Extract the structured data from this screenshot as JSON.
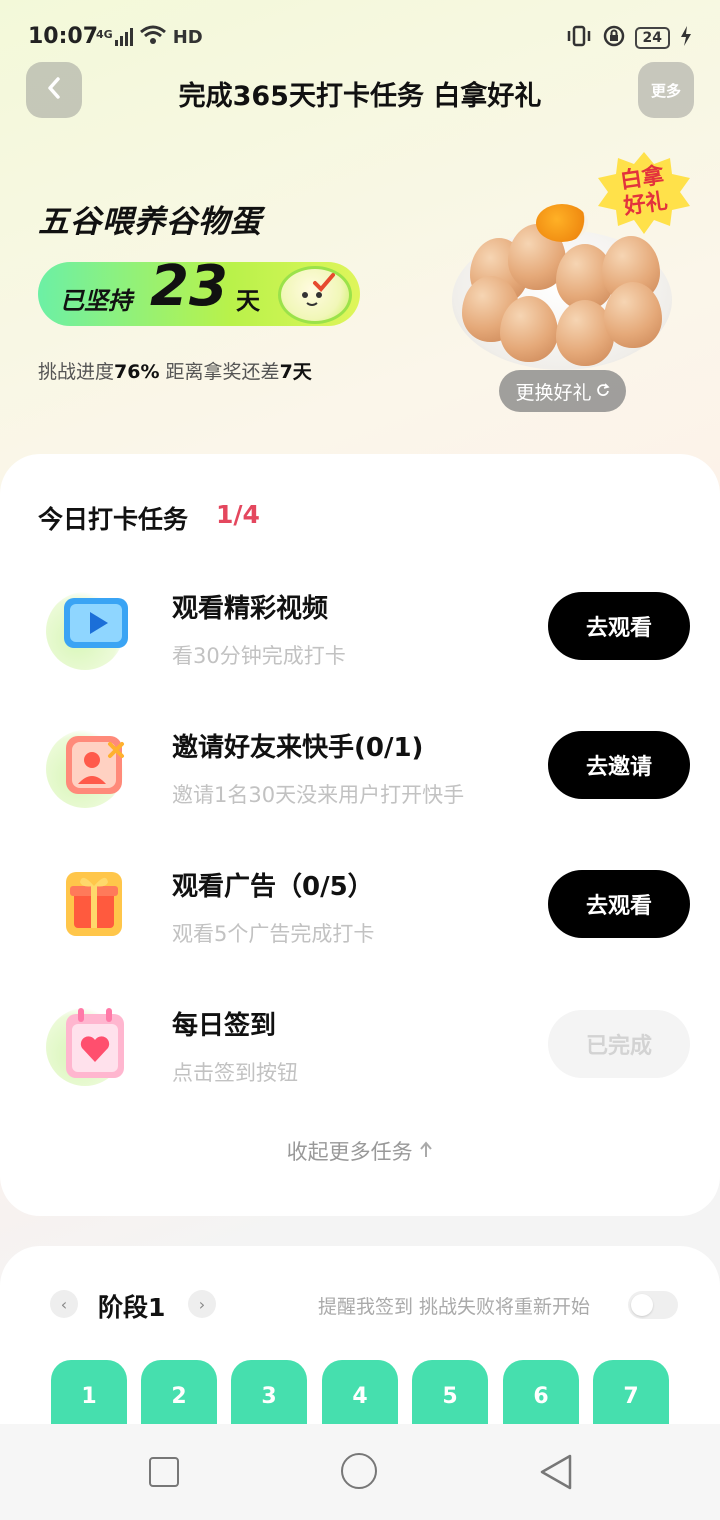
{
  "status_bar": {
    "time": "10:07",
    "signal_label": "4G",
    "wifi_label": "HD",
    "battery": "24"
  },
  "header": {
    "title": "完成365天打卡任务 白拿好礼",
    "more_label": "更多"
  },
  "hero": {
    "prize_name": "五谷喂养谷物蛋",
    "streak_prefix": "已坚持",
    "streak_days": "23",
    "streak_unit": "天",
    "progress_label": "挑战进度",
    "progress_value": "76%",
    "remaining_label": "距离拿奖还差",
    "remaining_value": "7天",
    "badge_line1": "白拿",
    "badge_line2": "好礼",
    "swap_label": "更换好礼"
  },
  "tasks": {
    "title": "今日打卡任务",
    "count": "1/4",
    "items": [
      {
        "title": "观看精彩视频",
        "desc": "看30分钟完成打卡",
        "button": "去观看",
        "done": false
      },
      {
        "title": "邀请好友来快手(0/1)",
        "desc": "邀请1名30天没来用户打开快手",
        "button": "去邀请",
        "done": false
      },
      {
        "title": "观看广告（0/5）",
        "desc": "观看5个广告完成打卡",
        "button": "去观看",
        "done": false
      },
      {
        "title": "每日签到",
        "desc": "点击签到按钮",
        "button": "已完成",
        "done": true
      }
    ],
    "collapse_label": "收起更多任务"
  },
  "stage": {
    "label": "阶段1",
    "hint": "提醒我签到 挑战失败将重新开始",
    "days": [
      "1",
      "2",
      "3",
      "4",
      "5",
      "6",
      "7"
    ]
  },
  "colors": {
    "accent_green": "#46dfae",
    "count_red": "#e4475e"
  }
}
